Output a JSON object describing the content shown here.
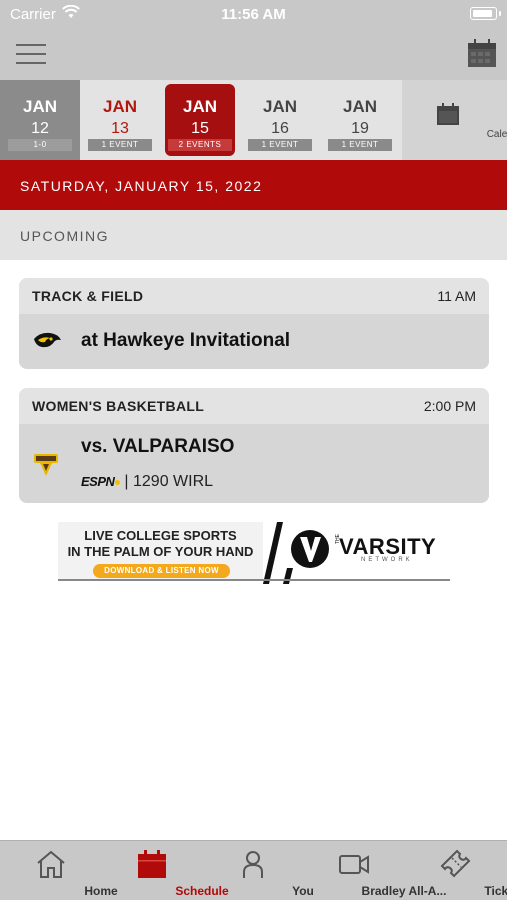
{
  "status_bar": {
    "carrier": "Carrier",
    "time": "11:56 AM"
  },
  "colors": {
    "brand_red": "#b00a0a",
    "selected_red": "#a50f0f",
    "bar_gray": "#c8c8c8"
  },
  "date_strip": {
    "items": [
      {
        "month": "JAN",
        "day": "12",
        "badge": "1-0"
      },
      {
        "month": "JAN",
        "day": "13",
        "badge": "1 EVENT"
      },
      {
        "month": "JAN",
        "day": "15",
        "badge": "2 EVENTS"
      },
      {
        "month": "JAN",
        "day": "16",
        "badge": "1 EVENT"
      },
      {
        "month": "JAN",
        "day": "19",
        "badge": "1 EVENT"
      }
    ],
    "calendar_label": "Calendar"
  },
  "date_header": "SATURDAY, JANUARY 15, 2022",
  "section_header": "UPCOMING",
  "events": [
    {
      "sport": "TRACK & FIELD",
      "time": "11 AM",
      "opponent": "at Hawkeye Invitational",
      "logo_icon": "iowa-hawkeye-logo"
    },
    {
      "sport": "WOMEN'S BASKETBALL",
      "time": "2:00 PM",
      "opponent": "vs. VALPARAISO",
      "network": "ESPN",
      "radio": "| 1290 WIRL",
      "logo_icon": "valparaiso-logo"
    }
  ],
  "ad": {
    "line1": "LIVE COLLEGE SPORTS",
    "line2": "IN THE PALM OF YOUR HAND",
    "button": "DOWNLOAD & LISTEN NOW",
    "brand_the": "THE",
    "brand": "VARSITY",
    "brand_sub": "NETWORK"
  },
  "tabs": [
    {
      "label": "Home",
      "icon": "home-icon"
    },
    {
      "label": "Schedule",
      "icon": "calendar-icon"
    },
    {
      "label": "You",
      "icon": "person-icon"
    },
    {
      "label": "Bradley All-A...",
      "icon": "video-icon"
    },
    {
      "label": "Tickets",
      "icon": "ticket-icon"
    }
  ]
}
